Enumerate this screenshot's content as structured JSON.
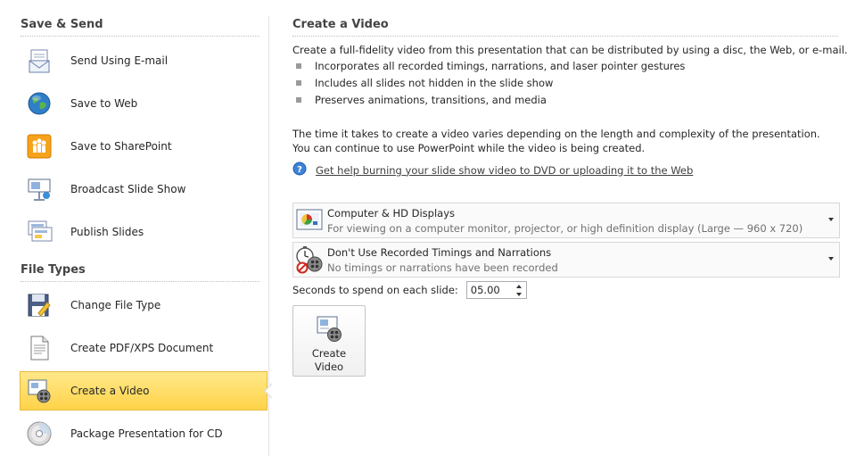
{
  "sidebar": {
    "sections": {
      "save_send": "Save & Send",
      "file_types": "File Types"
    },
    "items": [
      {
        "label": "Send Using E-mail",
        "icon": "email-icon"
      },
      {
        "label": "Save to Web",
        "icon": "globe-icon"
      },
      {
        "label": "Save to SharePoint",
        "icon": "sharepoint-icon"
      },
      {
        "label": "Broadcast Slide Show",
        "icon": "broadcast-icon"
      },
      {
        "label": "Publish Slides",
        "icon": "publish-slides-icon"
      },
      {
        "label": "Change File Type",
        "icon": "change-file-type-icon"
      },
      {
        "label": "Create PDF/XPS Document",
        "icon": "pdf-document-icon"
      },
      {
        "label": "Create a Video",
        "icon": "video-icon",
        "selected": true
      },
      {
        "label": "Package Presentation for CD",
        "icon": "cd-icon"
      }
    ],
    "selected_color": "#ffd349"
  },
  "main": {
    "title": "Create a Video",
    "intro": "Create a full-fidelity video from this presentation that can be distributed by using a disc, the Web, or e-mail.",
    "bullets": [
      "Incorporates all recorded timings, narrations, and laser pointer gestures",
      "Includes all slides not hidden in the slide show",
      "Preserves animations, transitions, and media"
    ],
    "timing_paragraph": "The time it takes to create a video varies depending on the length and complexity of the presentation. You can continue to use PowerPoint while the video is being created.",
    "help_link": "Get help burning your slide show video to DVD or uploading it to the Web",
    "quality_dropdown": {
      "title": "Computer & HD Displays",
      "subtitle": "For viewing on a computer monitor, projector, or high definition display  (Large — 960 x 720)",
      "icon": "display-icon"
    },
    "timings_dropdown": {
      "title": "Don't Use Recorded Timings and Narrations",
      "subtitle": "No timings or narrations have been recorded",
      "icon": "timings-icon"
    },
    "seconds": {
      "label": "Seconds to spend on each slide:",
      "value": "05.00"
    },
    "create_button": {
      "label": "Create\nVideo",
      "icon": "create-video-icon"
    }
  }
}
